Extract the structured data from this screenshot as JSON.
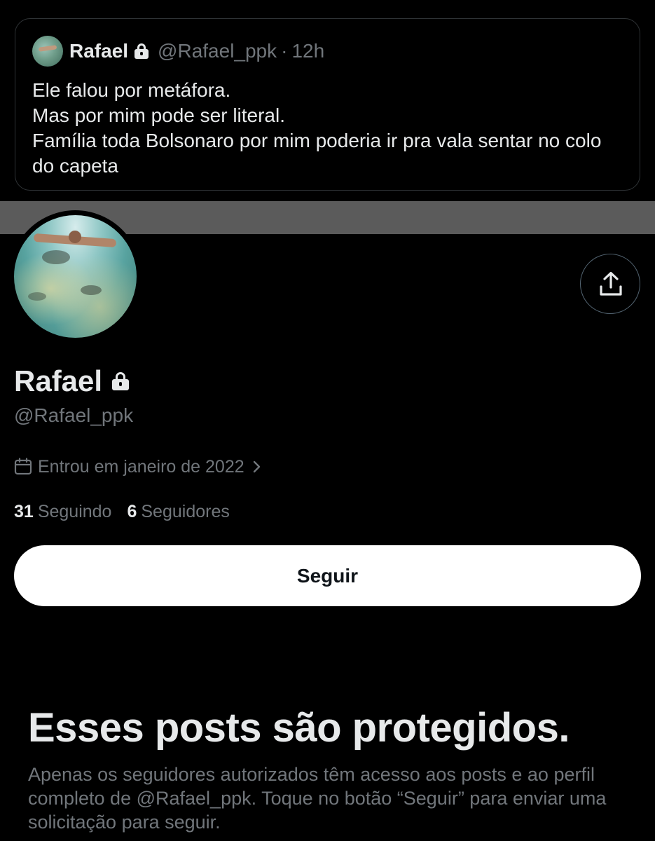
{
  "quoted_tweet": {
    "author_name": "Rafael",
    "handle": "@Rafael_ppk",
    "separator": "·",
    "time": "12h",
    "text": "Ele falou por metáfora.\nMas por mim pode ser literal.\nFamília toda Bolsonaro por mim poderia ir pra vala sentar no colo do capeta"
  },
  "profile": {
    "name": "Rafael",
    "handle": "@Rafael_ppk",
    "joined": "Entrou em janeiro de 2022",
    "following_count": "31",
    "following_label": "Seguindo",
    "followers_count": "6",
    "followers_label": "Seguidores",
    "follow_button": "Seguir"
  },
  "protected": {
    "title": "Esses posts são protegidos.",
    "description": "Apenas os seguidores autorizados têm acesso aos posts e ao perfil completo de @Rafael_ppk. Toque no botão “Seguir” para enviar uma solicitação para seguir."
  },
  "icons": {
    "lock": "lock-icon",
    "share": "share-icon",
    "calendar": "calendar-icon",
    "chevron": "chevron-right-icon"
  },
  "colors": {
    "background": "#000000",
    "text_primary": "#e7e9ea",
    "text_secondary": "#71767b",
    "banner": "#5b5b5b",
    "follow_button_bg": "#ffffff"
  }
}
